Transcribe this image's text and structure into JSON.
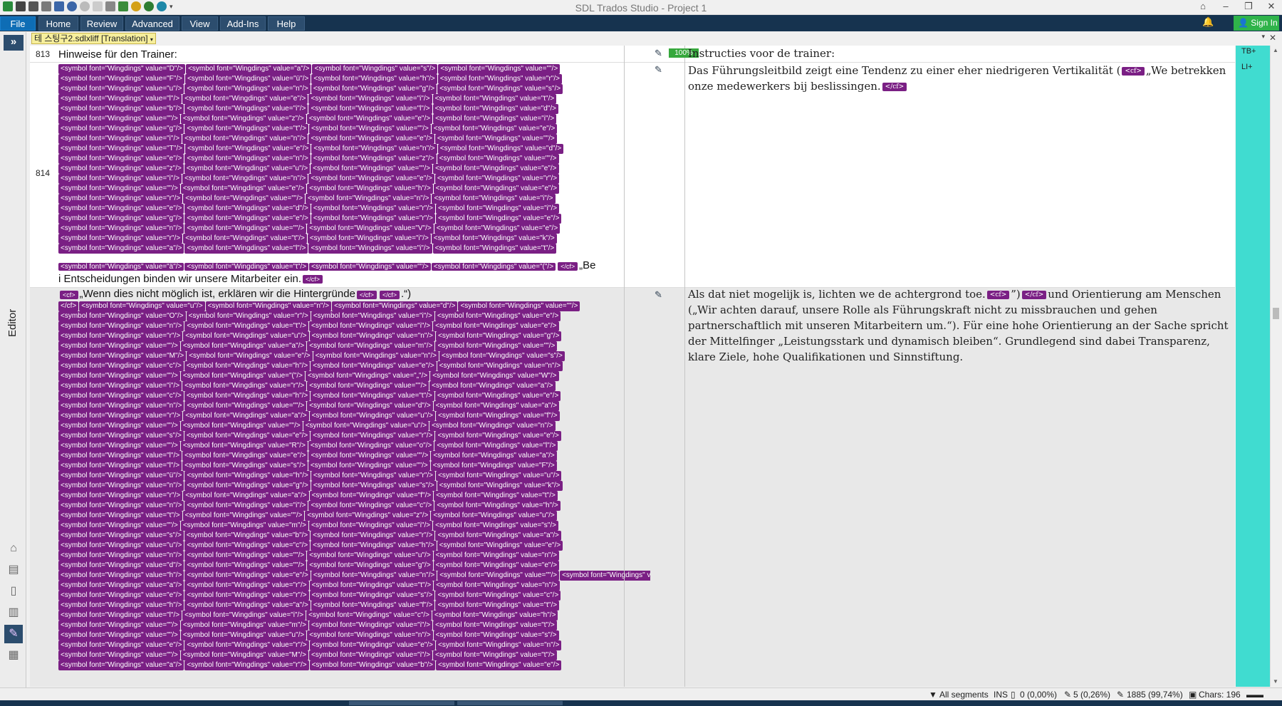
{
  "window": {
    "title": "SDL Trados Studio - Project 1",
    "controls": [
      "⌂",
      "–",
      "❐",
      "✕"
    ]
  },
  "ribbon": {
    "tabs": [
      "File",
      "Home",
      "Review",
      "Advanced",
      "View",
      "Add-Ins",
      "Help"
    ],
    "signin": "Sign In"
  },
  "sidebar": {
    "label": "Editor",
    "expand": "»"
  },
  "document_tab": {
    "label": "테 스팅구2.sdlxliff  [Translation]"
  },
  "right_panel": {
    "labels": [
      "TB+",
      "LI+"
    ]
  },
  "segments": [
    {
      "number": "813",
      "source": "Hinweise für den Trainer:",
      "match": "100%",
      "target": "Instructies voor de trainer:"
    },
    {
      "number": "814",
      "source_end": "„Be",
      "source_line2": "i Entscheidungen binden wir unsere Mitarbeiter ein.",
      "target_pre": "Das Führungsleitbild zeigt eine Tendenz zu einer eher niedrigeren Vertikalität (",
      "target_post": "„We betrekken onze medewerkers bij beslissingen."
    },
    {
      "number": "",
      "source_line1": "„Wenn dies nicht möglich ist, erklären wir die Hintergründe",
      "source_tail": ".“)",
      "target_a": "Als dat niet mogelijk is, lichten we de achtergrond toe.",
      "target_b": "”)",
      "target_c": "und Orientierung am Menschen („Wir achten darauf, unsere Rolle als Führungskraft nicht zu missbrauchen und gehen partnerschaftlich mit unseren Mitarbeitern um.“). Für eine hohe Orientierung an der Sache spricht der Mittelfinger „Leistungsstark und dynamisch bleiben“. Grundlegend sind dabei Transparenz, klare Ziele, hohe Qualifikationen und Sinnstiftung."
    }
  ],
  "tags": {
    "cf": "<cf>",
    "cf_close": "</cf>",
    "seg814_lines": [
      [
        "D",
        "a",
        "s",
        ""
      ],
      [
        "F",
        "ü",
        "h",
        "r"
      ],
      [
        "u",
        "n",
        "g",
        "s"
      ],
      [
        "l",
        "e",
        "i",
        "t"
      ],
      [
        "b",
        "i",
        "l",
        "d"
      ],
      [
        "",
        "z",
        "e",
        "i"
      ],
      [
        "g",
        "t",
        "",
        "e"
      ],
      [
        "i",
        "n",
        "e",
        ""
      ],
      [
        "T",
        "e",
        "n",
        "d"
      ],
      [
        "e",
        "n",
        "z",
        ""
      ],
      [
        "z",
        "u",
        "",
        "e"
      ],
      [
        "i",
        "n",
        "e",
        "r"
      ],
      [
        "",
        "e",
        "h",
        "e"
      ],
      [
        "r",
        "",
        "n",
        "i"
      ],
      [
        "e",
        "d",
        "r",
        "i"
      ],
      [
        "g",
        "e",
        "r",
        "e"
      ],
      [
        "n",
        "",
        "V",
        "e"
      ],
      [
        "r",
        "t",
        "i",
        "k"
      ],
      [
        "a",
        "l",
        "i",
        "t"
      ]
    ],
    "seg814_last": [
      "ä",
      "t",
      "",
      "("
    ],
    "seg815_first": [
      "u",
      "n",
      "d",
      ""
    ],
    "seg815_lines": [
      [
        "O",
        "r",
        "i",
        "e"
      ],
      [
        "n",
        "t",
        "i",
        "e"
      ],
      [
        "r",
        "u",
        "n",
        "g"
      ],
      [
        "",
        "a",
        "m",
        ""
      ],
      [
        "M",
        "e",
        "n",
        "s"
      ],
      [
        "c",
        "h",
        "e",
        "n"
      ],
      [
        "",
        "(",
        "„",
        "W"
      ],
      [
        "i",
        "r",
        "",
        "a"
      ],
      [
        "c",
        "h",
        "t",
        "e"
      ],
      [
        "n",
        "",
        "d",
        "a"
      ],
      [
        "r",
        "a",
        "u",
        "f"
      ],
      [
        "",
        "",
        "u",
        "n"
      ],
      [
        "s",
        "e",
        "r",
        "e"
      ],
      [
        "",
        "R",
        "o",
        "l"
      ],
      [
        "l",
        "e",
        "",
        "a"
      ],
      [
        "l",
        "s",
        "",
        "F"
      ],
      [
        "ü",
        "h",
        "r",
        "u"
      ],
      [
        "n",
        "g",
        "s",
        "k"
      ],
      [
        "r",
        "a",
        "f",
        "t"
      ],
      [
        "n",
        "i",
        "c",
        "h"
      ],
      [
        "t",
        "",
        "z",
        "u"
      ],
      [
        "",
        "m",
        "i",
        "s"
      ],
      [
        "s",
        "b",
        "r",
        "a"
      ],
      [
        "u",
        "c",
        "h",
        "e"
      ],
      [
        "n",
        "",
        "u",
        "n"
      ],
      [
        "d",
        "",
        "g",
        "e"
      ],
      [
        "h",
        "e",
        "n",
        "",
        "p"
      ],
      [
        "a",
        "r",
        "t",
        "n"
      ],
      [
        "e",
        "r",
        "s",
        "c"
      ],
      [
        "h",
        "a",
        "f",
        "t"
      ],
      [
        "l",
        "i",
        "c",
        "h"
      ],
      [
        "",
        "m",
        "i",
        "t"
      ],
      [
        "",
        "u",
        "n",
        "s"
      ],
      [
        "e",
        "r",
        "e",
        "n"
      ],
      [
        "",
        "M",
        "i",
        "t"
      ],
      [
        "a",
        "r",
        "b",
        "e"
      ]
    ]
  },
  "status": {
    "filter": "All segments",
    "mode": "INS",
    "s1": "0 (0,00%)",
    "s2": "5 (0,26%)",
    "s3": "1885 (99,74%)",
    "chars": "Chars: 196"
  }
}
